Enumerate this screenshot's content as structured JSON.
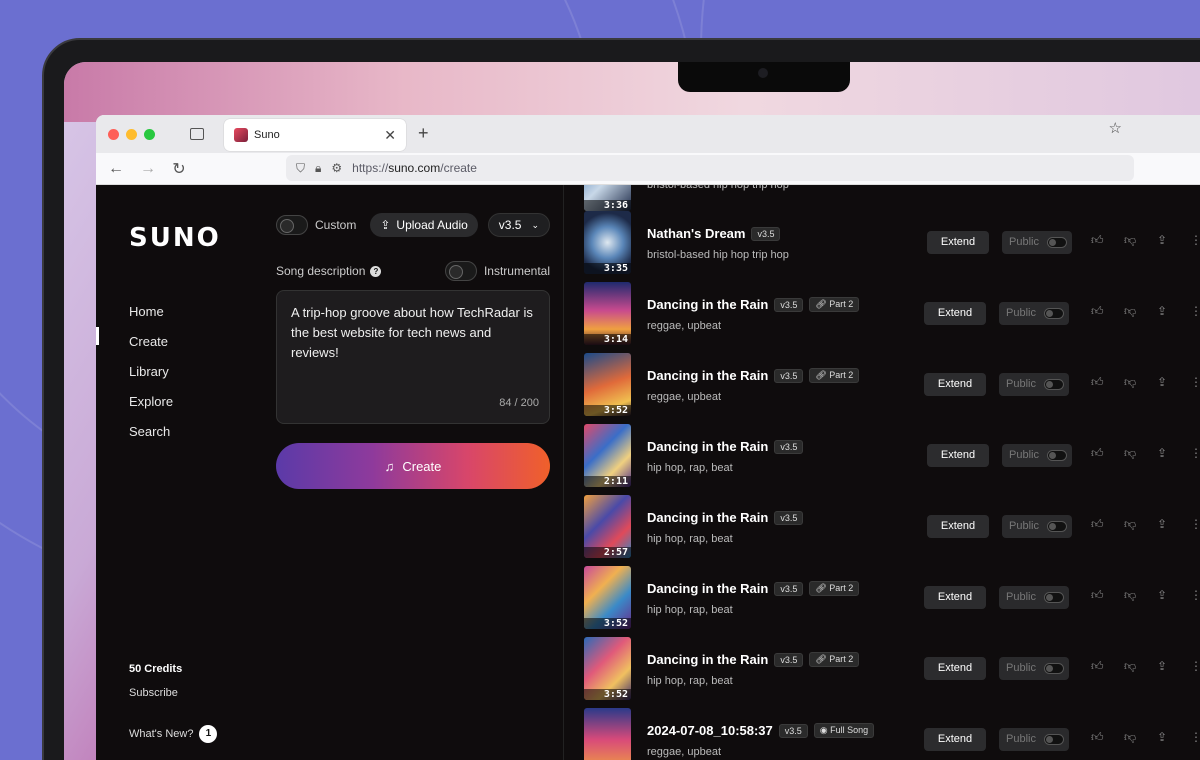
{
  "browser": {
    "tab_title": "Suno",
    "url_prefix": "https://",
    "url_domain": "suno.com",
    "url_path": "/create"
  },
  "sidebar": {
    "logo": "SUNO",
    "items": [
      {
        "label": "Home"
      },
      {
        "label": "Create"
      },
      {
        "label": "Library"
      },
      {
        "label": "Explore"
      },
      {
        "label": "Search"
      }
    ],
    "credits": "50 Credits",
    "subscribe": "Subscribe",
    "whats_new": "What's New?",
    "whats_new_count": "1"
  },
  "create": {
    "custom_label": "Custom",
    "upload_label": "Upload Audio",
    "version": "v3.5",
    "song_description_label": "Song description",
    "instrumental_label": "Instrumental",
    "description_text": "A trip-hop groove about how TechRadar is the best website for tech news and reviews!",
    "counter": "84 / 200",
    "create_button": "Create"
  },
  "songs": [
    {
      "title": "",
      "version": "",
      "tag": "",
      "desc": "bristol-based hip hop trip hop",
      "duration": "3:36"
    },
    {
      "title": "Nathan's Dream",
      "version": "v3.5",
      "tag": "",
      "desc": "bristol-based hip hop trip hop",
      "duration": "3:35"
    },
    {
      "title": "Dancing in the Rain",
      "version": "v3.5",
      "tag": "Part 2",
      "desc": "reggae, upbeat",
      "duration": "3:14"
    },
    {
      "title": "Dancing in the Rain",
      "version": "v3.5",
      "tag": "Part 2",
      "desc": "reggae, upbeat",
      "duration": "3:52"
    },
    {
      "title": "Dancing in the Rain",
      "version": "v3.5",
      "tag": "",
      "desc": "hip hop, rap, beat",
      "duration": "2:11"
    },
    {
      "title": "Dancing in the Rain",
      "version": "v3.5",
      "tag": "",
      "desc": "hip hop, rap, beat",
      "duration": "2:57"
    },
    {
      "title": "Dancing in the Rain",
      "version": "v3.5",
      "tag": "Part 2",
      "desc": "hip hop, rap, beat",
      "duration": "3:52"
    },
    {
      "title": "Dancing in the Rain",
      "version": "v3.5",
      "tag": "Part 2",
      "desc": "hip hop, rap, beat",
      "duration": "3:52"
    },
    {
      "title": "2024-07-08_10:58:37",
      "version": "v3.5",
      "tag": "Full Song",
      "desc": "reggae, upbeat",
      "duration": ""
    }
  ],
  "song_actions": {
    "extend": "Extend",
    "public": "Public"
  },
  "icons": {
    "like": "thumbs-up-icon",
    "dislike": "thumbs-down-icon",
    "share": "share-icon",
    "more": "more-icon"
  }
}
